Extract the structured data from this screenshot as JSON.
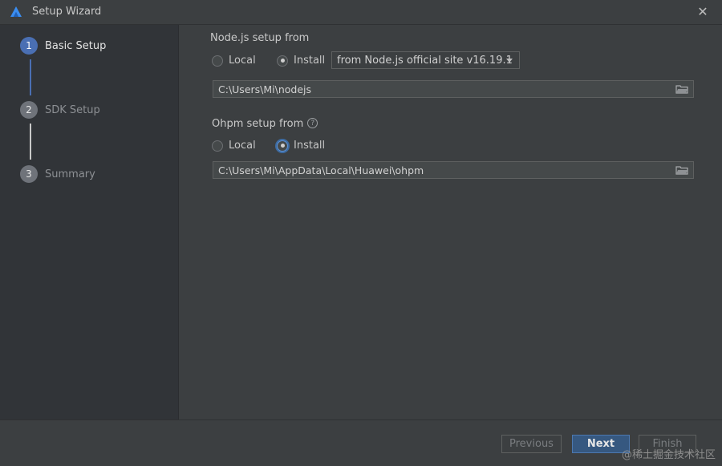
{
  "window": {
    "title": "Setup Wizard",
    "logo_icon": "harmony-logo-icon",
    "close_glyph": "✕"
  },
  "steps": [
    {
      "number": "1",
      "label": "Basic Setup",
      "active": true
    },
    {
      "number": "2",
      "label": "SDK Setup",
      "active": false
    },
    {
      "number": "3",
      "label": "Summary",
      "active": false
    }
  ],
  "node": {
    "section_title": "Node.js setup from",
    "option_local": "Local",
    "option_install": "Install",
    "selected": "Install",
    "source_dropdown": "from Node.js official site v16.19.1",
    "path": "C:\\Users\\Mi\\nodejs"
  },
  "ohpm": {
    "section_title": "Ohpm setup from",
    "help_glyph": "?",
    "option_local": "Local",
    "option_install": "Install",
    "selected": "Install",
    "path": "C:\\Users\\Mi\\AppData\\Local\\Huawei\\ohpm"
  },
  "footer": {
    "previous_label": "Previous",
    "next_label": "Next",
    "finish_label": "Finish"
  },
  "watermark": "@稀土掘金技术社区",
  "colors": {
    "accent": "#4a6fb3",
    "background": "#3c3f41",
    "sidebar": "#313438"
  }
}
